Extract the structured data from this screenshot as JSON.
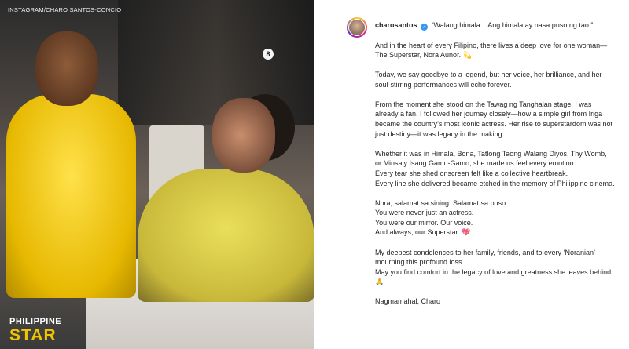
{
  "photo": {
    "credit": "INSTAGRAM/CHARO SANTOS-CONCIO",
    "table_number": "8",
    "logo_line1": "PHILIPPINE",
    "logo_line2": "STAR"
  },
  "post": {
    "username": "charosantos",
    "verified_icon": "verified-badge-icon",
    "first_paragraph": "“Walang himala... Ang himala ay nasa puso ng tao.”",
    "paragraphs": [
      "And in the heart of every Filipino, there lives a deep love for one woman—The Superstar, Nora Aunor. 💫",
      "Today, we say goodbye to a legend, but her voice, her brilliance, and her soul-stirring performances will echo forever.",
      "From the moment she stood on the Tawag ng Tanghalan stage, I was already a fan. I followed her journey closely—how a simple girl from Iriga became the country’s most iconic actress. Her rise to superstardom was not just destiny—it was legacy in the making.",
      "Whether it was in Himala, Bona, Tatlong Taong Walang Diyos, Thy Womb, or Minsa’y Isang Gamu-Gamo, she made us feel every emotion.\nEvery tear she shed onscreen felt like a collective heartbreak.\nEvery line she delivered became etched in the memory of Philippine cinema.",
      "Nora, salamat sa sining. Salamat sa puso.\nYou were never just an actress.\nYou were our mirror. Our voice.\nAnd always, our Superstar. 💖",
      "My deepest condolences to her family, friends, and to every ‘Noranian’ mourning this profound loss.\nMay you find comfort in the legacy of love and greatness she leaves behind. 🙏",
      "Nagmamahal, Charo"
    ]
  }
}
